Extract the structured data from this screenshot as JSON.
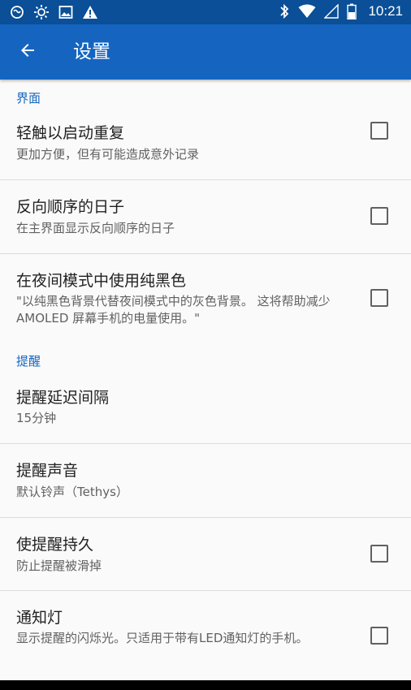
{
  "status_bar": {
    "time": "10:21",
    "icons_left": [
      "messaging-icon",
      "brightness-icon",
      "image-icon",
      "warning-icon"
    ],
    "icons_right": [
      "bluetooth-icon",
      "wifi-icon",
      "cell-signal-icon",
      "battery-icon"
    ]
  },
  "app_bar": {
    "title": "设置",
    "back_icon": "arrow-back-icon"
  },
  "sections": {
    "interface": {
      "header": "界面",
      "items": [
        {
          "title": "轻触以启动重复",
          "summary": "更加方便，但有可能造成意外记录",
          "checked": false
        },
        {
          "title": "反向顺序的日子",
          "summary": "在主界面显示反向顺序的日子",
          "checked": false
        },
        {
          "title": "在夜间模式中使用纯黑色",
          "summary": "\"以纯黑色背景代替夜间模式中的灰色背景。 这将帮助减少 AMOLED 屏幕手机的电量使用。\"",
          "checked": false
        }
      ]
    },
    "reminders": {
      "header": "提醒",
      "items": [
        {
          "title": "提醒延迟间隔",
          "summary": "15分钟"
        },
        {
          "title": "提醒声音",
          "summary": "默认铃声（Tethys）"
        },
        {
          "title": "使提醒持久",
          "summary": "防止提醒被滑掉",
          "checked": false
        },
        {
          "title": "通知灯",
          "summary": "显示提醒的闪烁光。只适用于带有LED通知灯的手机。",
          "checked": false
        }
      ]
    }
  },
  "colors": {
    "status_bar": "#0a4f97",
    "app_bar": "#1565c0",
    "accent": "#1565c0",
    "background": "#fafafa"
  }
}
